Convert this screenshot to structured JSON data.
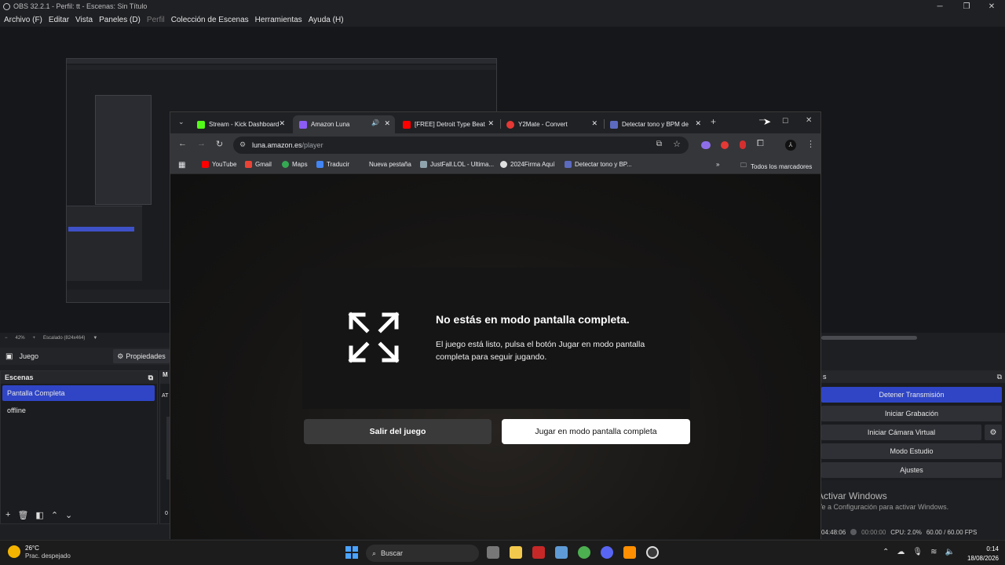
{
  "obs": {
    "title": "OBS 32.2.1 - Perfil: tt - Escenas: Sin Título",
    "menu": [
      {
        "label": "Archivo (F)",
        "dim": false
      },
      {
        "label": "Editar",
        "dim": false
      },
      {
        "label": "Vista",
        "dim": false
      },
      {
        "label": "Paneles (D)",
        "dim": false
      },
      {
        "label": "Perfil",
        "dim": true
      },
      {
        "label": "Colección de Escenas",
        "dim": false
      },
      {
        "label": "Herramientas",
        "dim": false
      },
      {
        "label": "Ayuda (H)",
        "dim": false
      }
    ],
    "zoom": {
      "percent": "42%",
      "scale_label": "Escalado (824x464)"
    },
    "scene_name": "Juego",
    "properties_label": "Propiedades",
    "scenes": {
      "header": "Escenas",
      "items": [
        {
          "label": "Pantalla Completa",
          "selected": true
        },
        {
          "label": "offline",
          "selected": false
        }
      ]
    },
    "mixer_stub": {
      "header": "M",
      "label": "AT",
      "value": "0"
    },
    "controls": {
      "header": "s",
      "buttons": [
        "Detener Transmisión",
        "Iniciar Grabación",
        "Iniciar Cámara Virtual",
        "Modo Estudio",
        "Ajustes"
      ]
    },
    "status": {
      "stream_time": "04:48:06",
      "rec_time": "00:00:00",
      "cpu": "CPU: 2.0%",
      "fps": "60.00 / 60.00 FPS"
    },
    "activate_windows": {
      "title": "Activar Windows",
      "subtitle": "Ve a Configuración para activar Windows."
    }
  },
  "chrome": {
    "tabs": [
      {
        "label": "Stream - Kick Dashboard",
        "color": "#53fc18",
        "active": false
      },
      {
        "label": "Amazon Luna",
        "color": "#8b5cf6",
        "active": true
      },
      {
        "label": "[FREE] Detroit Type Beat",
        "color": "#ff0000",
        "active": false
      },
      {
        "label": "Y2Mate - Convert",
        "color": "#e53935",
        "active": false
      },
      {
        "label": "Detectar tono y BPM de",
        "color": "#5c6bc0",
        "active": false
      }
    ],
    "url": {
      "host": "luna.amazon.es",
      "path": "/player"
    },
    "bookmarks": [
      {
        "label": "YouTube",
        "color": "#ff0000"
      },
      {
        "label": "Gmail",
        "color": "#ea4335"
      },
      {
        "label": "Maps",
        "color": "#34a853"
      },
      {
        "label": "Traducir",
        "color": "#4285f4"
      },
      {
        "label": "Nueva pestaña",
        "color": "#35363a"
      },
      {
        "label": "JustFall.LOL - Ultima...",
        "color": "#90a4ae"
      },
      {
        "label": "2024Firma Aquí",
        "color": "#e0e0e0"
      },
      {
        "label": "Detectar tono y BP...",
        "color": "#5c6bc0"
      }
    ],
    "all_bookmarks": "Todos los marcadores",
    "page": {
      "title": "No estás en modo pantalla completa.",
      "body": "El juego está listo, pulsa el botón Jugar en modo pantalla completa para seguir jugando.",
      "exit_button": "Salir del juego",
      "play_button": "Jugar en modo pantalla completa"
    }
  },
  "taskbar": {
    "weather_temp": "26°C",
    "weather_desc": "Prac. despejado",
    "search_placeholder": "Buscar",
    "time": "0:14",
    "date": "18/08/2026"
  }
}
